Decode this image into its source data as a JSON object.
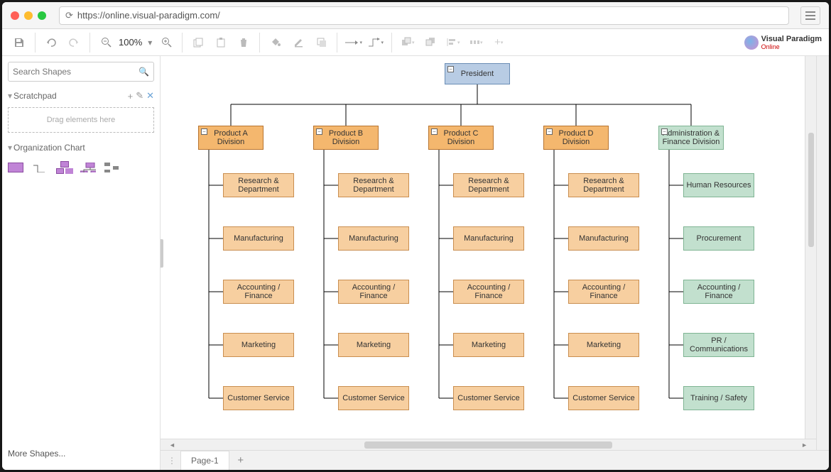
{
  "browser": {
    "url": "https://online.visual-paradigm.com/"
  },
  "toolbar": {
    "zoom": "100%"
  },
  "brand": {
    "name": "Visual Paradigm",
    "sub": "Online"
  },
  "sidebar": {
    "search_placeholder": "Search Shapes",
    "scratchpad": "Scratchpad",
    "dropzone": "Drag elements here",
    "org_chart": "Organization Chart",
    "more_shapes": "More Shapes..."
  },
  "tabs": {
    "page1": "Page-1"
  },
  "chart_data": {
    "type": "org_chart",
    "root": {
      "label": "President",
      "style": "blue"
    },
    "divisions": [
      {
        "label": "Product A Division",
        "style": "orange",
        "children": [
          {
            "label": "Research & Department",
            "style": "peach"
          },
          {
            "label": "Manufacturing",
            "style": "peach"
          },
          {
            "label": "Accounting / Finance",
            "style": "peach"
          },
          {
            "label": "Marketing",
            "style": "peach"
          },
          {
            "label": "Customer Service",
            "style": "peach"
          }
        ]
      },
      {
        "label": "Product B Division",
        "style": "orange",
        "children": [
          {
            "label": "Research & Department",
            "style": "peach"
          },
          {
            "label": "Manufacturing",
            "style": "peach"
          },
          {
            "label": "Accounting / Finance",
            "style": "peach"
          },
          {
            "label": "Marketing",
            "style": "peach"
          },
          {
            "label": "Customer Service",
            "style": "peach"
          }
        ]
      },
      {
        "label": "Product C Division",
        "style": "orange",
        "children": [
          {
            "label": "Research & Department",
            "style": "peach"
          },
          {
            "label": "Manufacturing",
            "style": "peach"
          },
          {
            "label": "Accounting / Finance",
            "style": "peach"
          },
          {
            "label": "Marketing",
            "style": "peach"
          },
          {
            "label": "Customer Service",
            "style": "peach"
          }
        ]
      },
      {
        "label": "Product D Division",
        "style": "orange",
        "children": [
          {
            "label": "Research & Department",
            "style": "peach"
          },
          {
            "label": "Manufacturing",
            "style": "peach"
          },
          {
            "label": "Accounting / Finance",
            "style": "peach"
          },
          {
            "label": "Marketing",
            "style": "peach"
          },
          {
            "label": "Customer Service",
            "style": "peach"
          }
        ]
      },
      {
        "label": "Administration & Finance Division",
        "style": "green",
        "children": [
          {
            "label": "Human Resources",
            "style": "green"
          },
          {
            "label": "Procurement",
            "style": "green"
          },
          {
            "label": "Accounting / Finance",
            "style": "green"
          },
          {
            "label": "PR / Communications",
            "style": "green"
          },
          {
            "label": "Training / Safety",
            "style": "green"
          }
        ]
      }
    ]
  }
}
